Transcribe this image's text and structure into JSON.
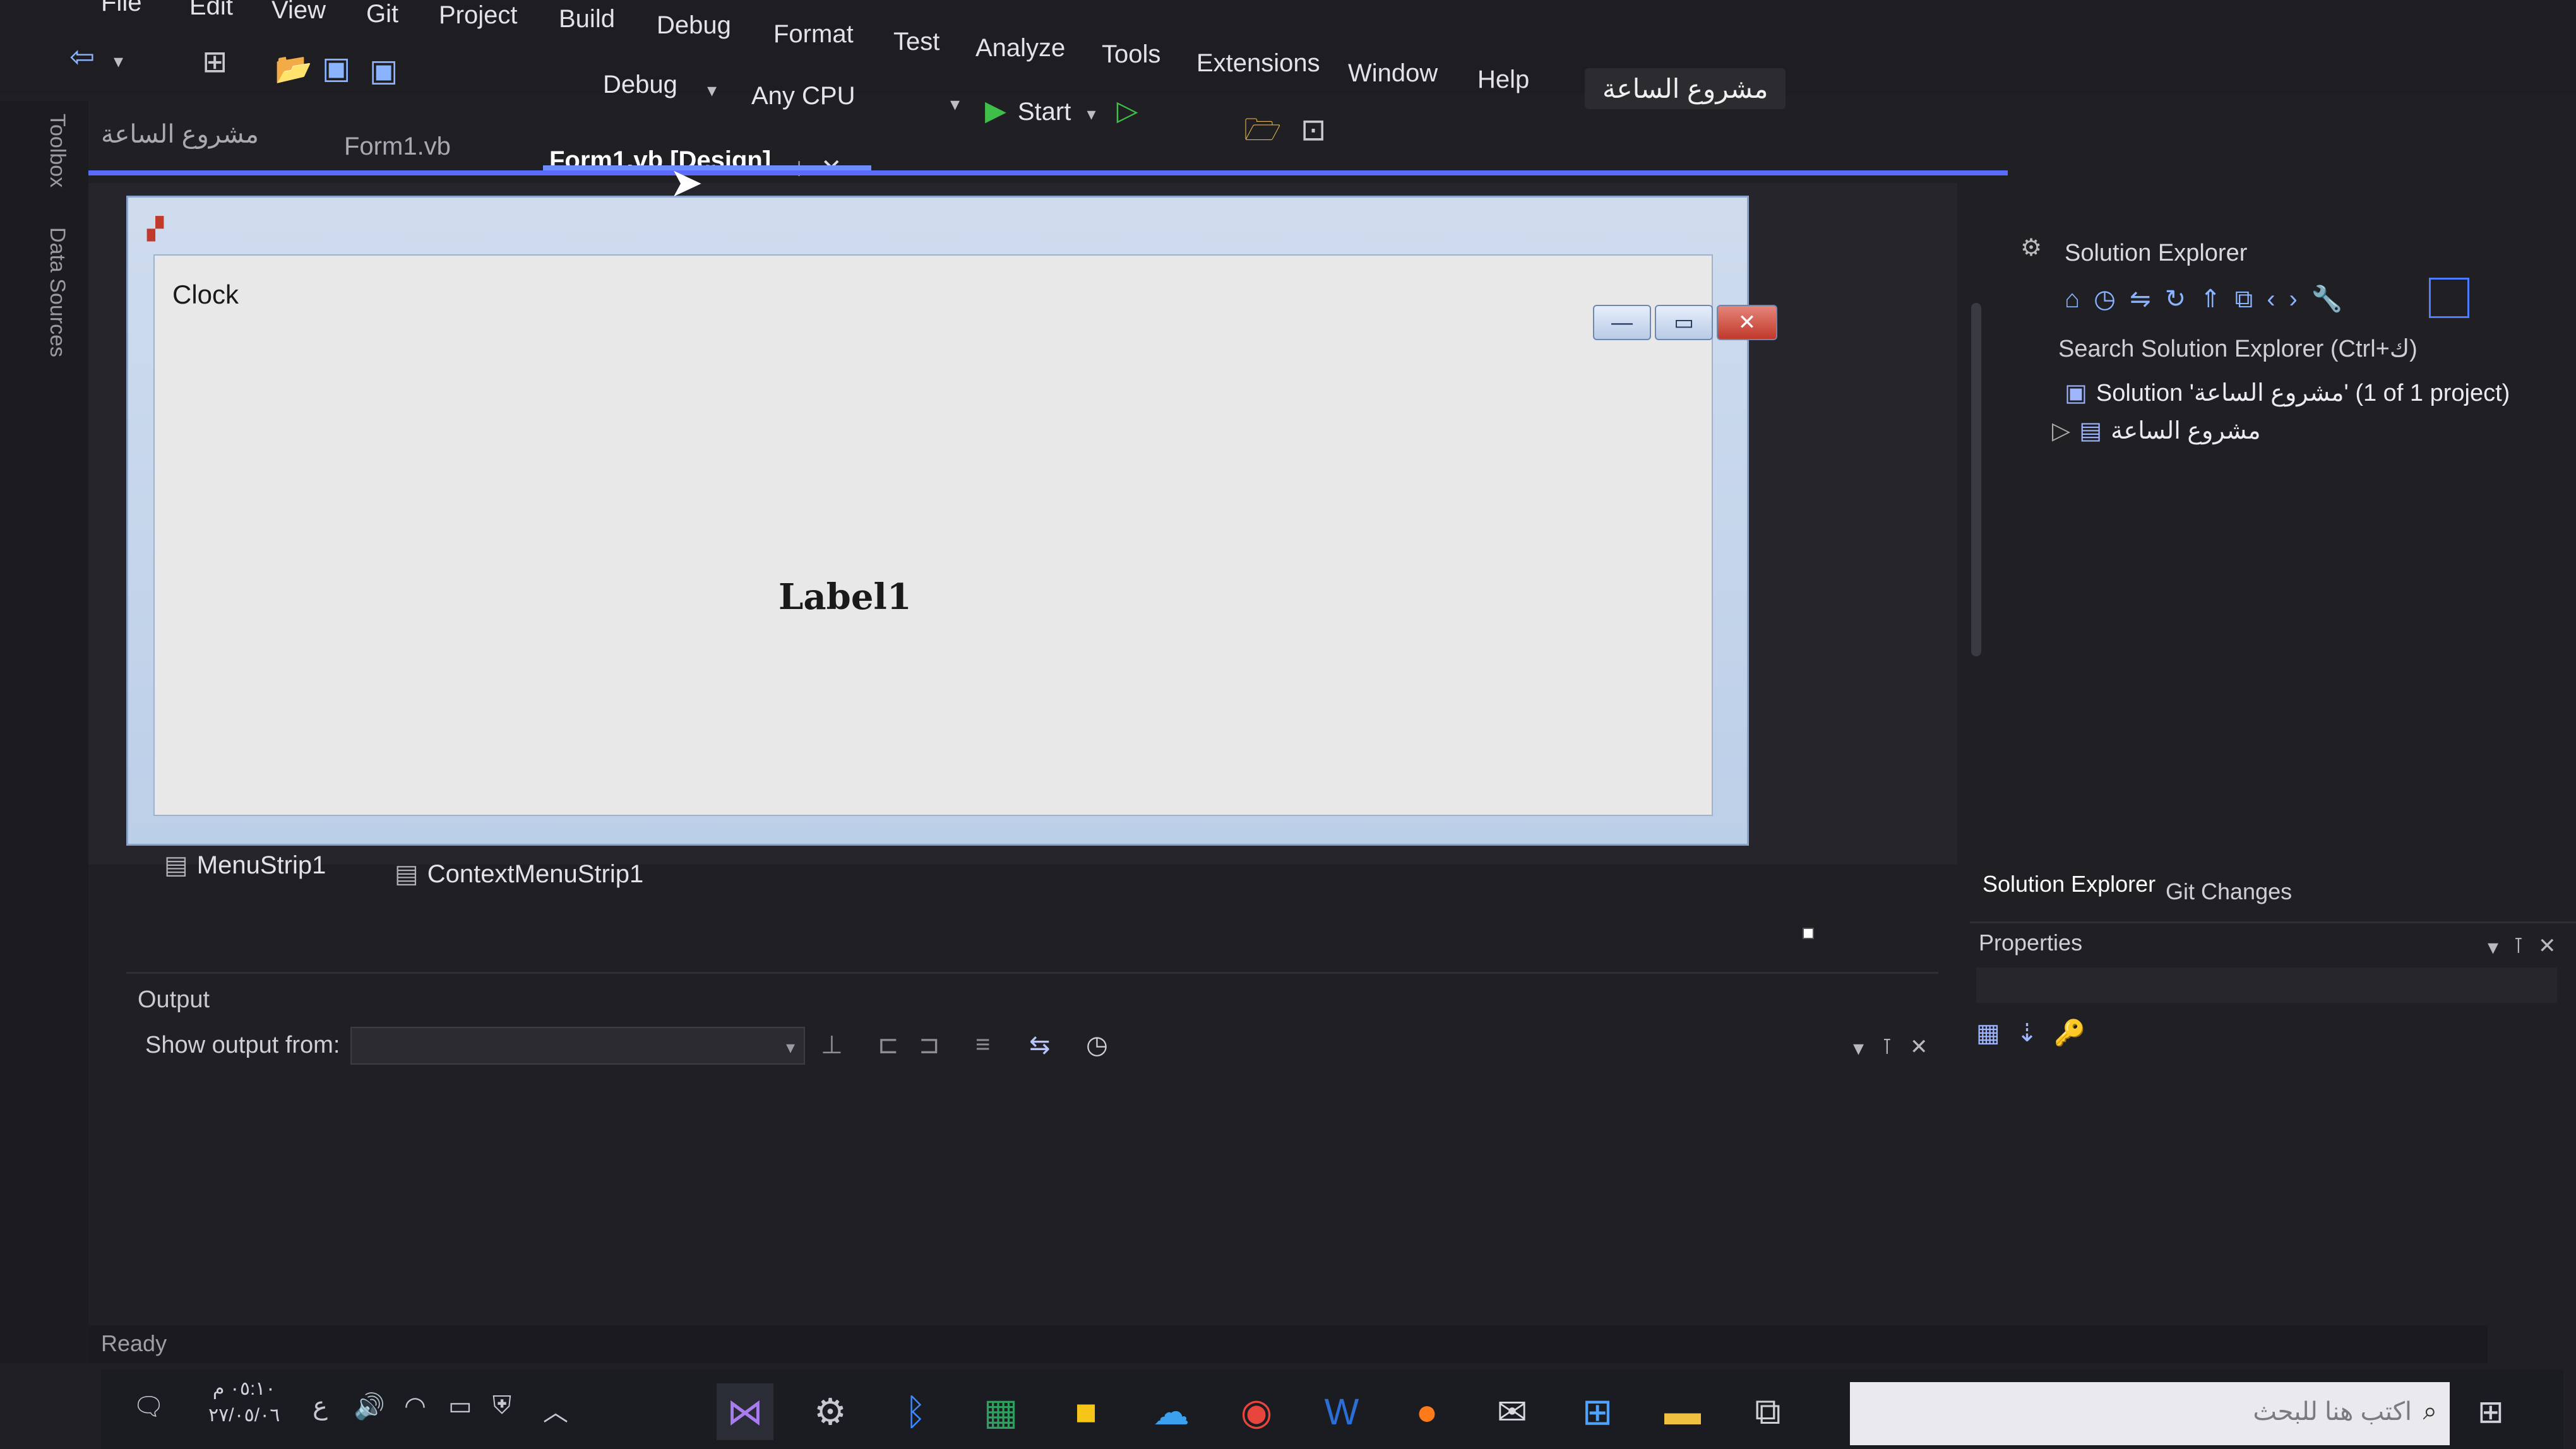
{
  "menu": {
    "items": [
      "File",
      "Edit",
      "View",
      "Git",
      "Project",
      "Build",
      "Debug",
      "Format",
      "Test",
      "Analyze",
      "Tools",
      "Extensions",
      "Window",
      "Help"
    ],
    "project_title": "مشروع الساعة"
  },
  "toolbar": {
    "config": "Debug",
    "platform": "Any CPU",
    "start": "Start"
  },
  "left_rail": {
    "toolbox": "Toolbox",
    "data_sources": "Data Sources"
  },
  "tabs": [
    {
      "label": "مشروع الساعة"
    },
    {
      "label": "Form1.vb"
    },
    {
      "label": "Form1.vb [Design]"
    }
  ],
  "designer": {
    "form_title": "Clock",
    "label1": "Label1",
    "win_buttons": {
      "minimize": "—",
      "maximize": "▭",
      "close": "✕"
    }
  },
  "tray": {
    "items": [
      "MenuStrip1",
      "ContextMenuStrip1"
    ]
  },
  "output": {
    "title": "Output",
    "show_from_label": "Show output from:",
    "show_from_value": ""
  },
  "solution_explorer": {
    "title": "Solution Explorer",
    "search": "Search Solution Explorer (Ctrl+ك)",
    "solution_row": "Solution 'مشروع الساعة' (1 of 1 project)",
    "project_row": "مشروع الساعة",
    "tabs": [
      "Solution Explorer",
      "Git Changes"
    ]
  },
  "properties": {
    "title": "Properties"
  },
  "status": {
    "text": "Ready"
  },
  "taskbar": {
    "time": "٠٥:١٠ م",
    "date": "٢٧/٠٥/٠٦",
    "lang": "ع",
    "search_placeholder": "اكتب هنا للبحث"
  }
}
